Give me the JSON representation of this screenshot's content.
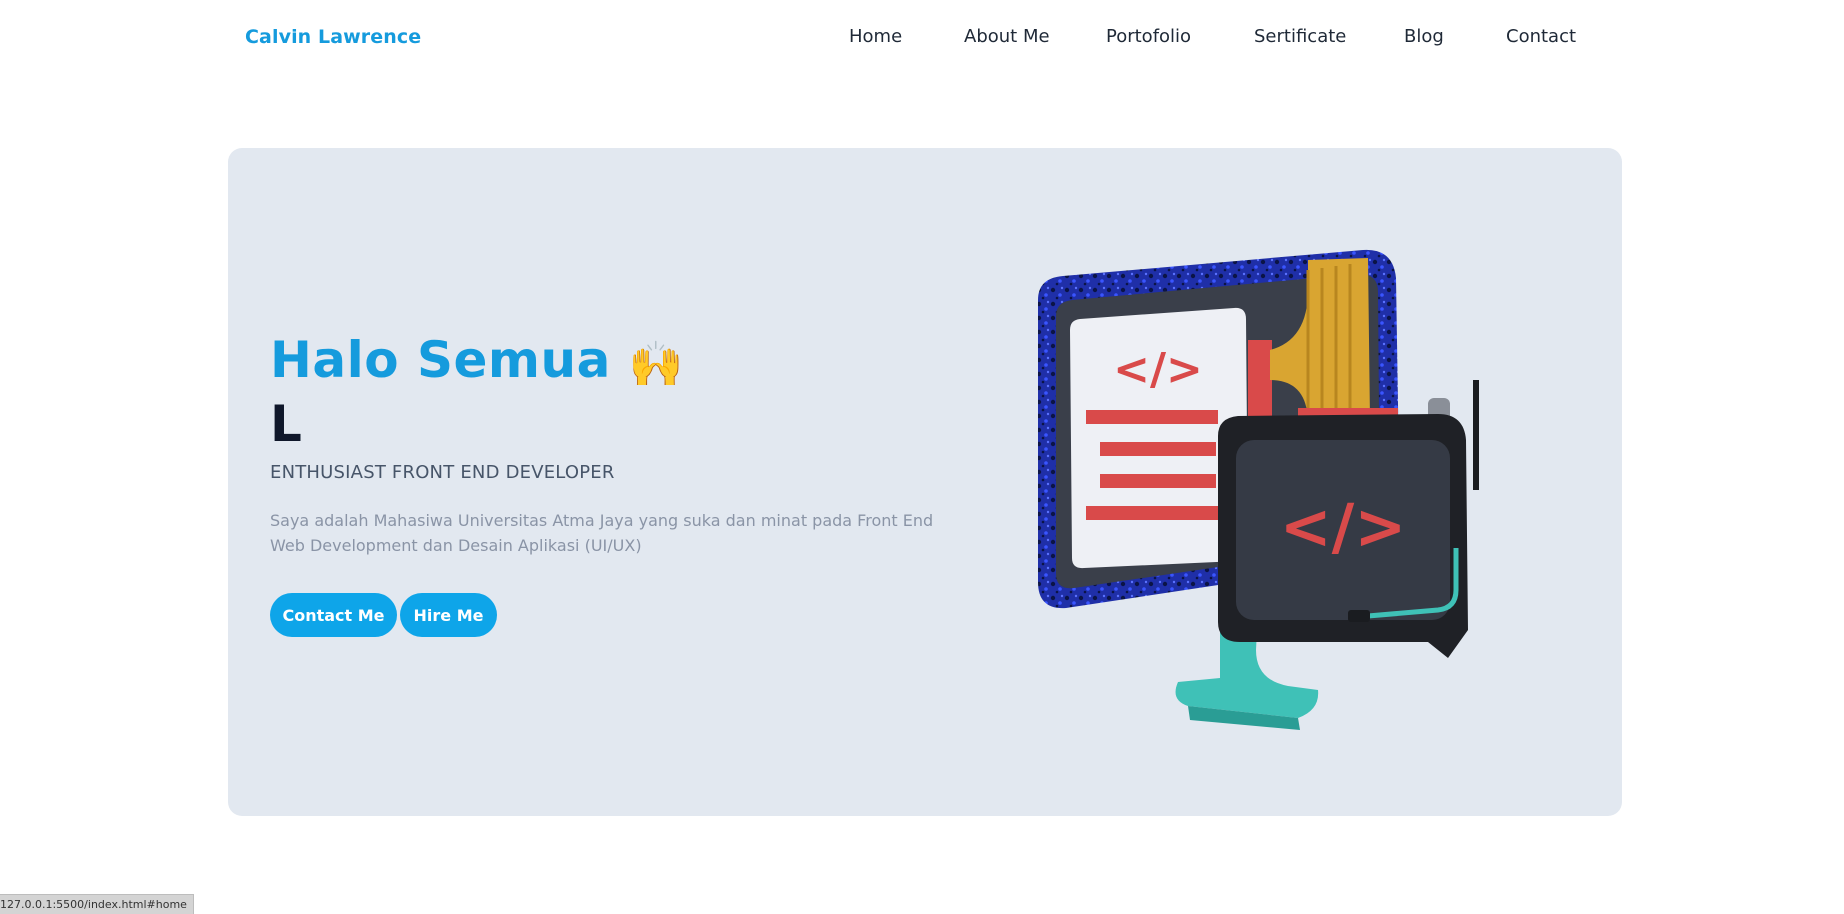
{
  "brand": {
    "name": "Calvin Lawrence"
  },
  "nav": {
    "items": [
      {
        "label": "Home"
      },
      {
        "label": "About Me"
      },
      {
        "label": "Portofolio"
      },
      {
        "label": "Sertificate"
      },
      {
        "label": "Blog"
      },
      {
        "label": "Contact"
      }
    ]
  },
  "hero": {
    "greeting": "Halo Semua",
    "greeting_emoji": "🙌",
    "typed_text": "L",
    "role": "ENTHUSIAST FRONT END DEVELOPER",
    "description": "Saya adalah Mahasiwa Universitas Atma Jaya yang suka dan minat pada Front End Web Development dan Desain Aplikasi (UI/UX)",
    "buttons": {
      "contact": "Contact Me",
      "hire": "Hire Me"
    },
    "illustration": "monitor-and-tablet-code-icon"
  },
  "status_bar": {
    "url": "127.0.0.1:5500/index.html#home"
  },
  "colors": {
    "accent": "#159bdd",
    "button": "#0ea5e9",
    "hero_bg": "#e2e8f0",
    "code_red": "#d94a4a",
    "stand_teal": "#3fc1b7"
  }
}
